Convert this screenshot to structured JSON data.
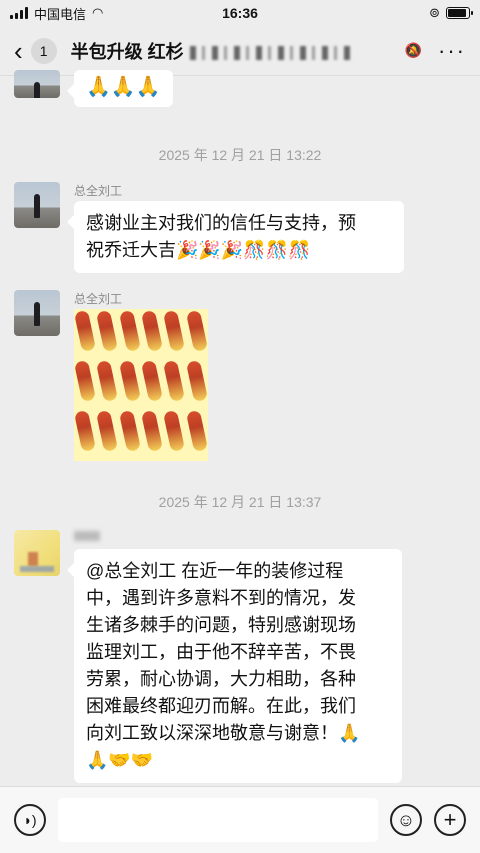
{
  "status_bar": {
    "carrier": "中国电信",
    "time": "16:36"
  },
  "header": {
    "back_count": "1",
    "title": "半包升级 红杉"
  },
  "messages": {
    "m1": {
      "content": "🙏🙏🙏"
    },
    "ts1": "2025 年 12 月 21 日 13:22",
    "m2": {
      "sender": "总全刘工",
      "text_line1": "感谢业主对我们的信任与支持，预",
      "text_line2": "祝乔迁大吉🎉🎉🎉🎊🎊🎊"
    },
    "m3": {
      "sender": "总全刘工"
    },
    "ts2": "2025 年 12 月 21 日 13:37",
    "m4": {
      "lines": [
        "@总全刘工 在近一年的装修过程",
        "中，遇到许多意料不到的情况，发",
        "生诸多棘手的问题，特别感谢现场",
        "监理刘工，由于他不辞辛苦，不畏",
        "劳累，耐心协调，大力相助，各种",
        "困难最终都迎刃而解。在此，我们",
        "向刘工致以深深地敬意与谢意！🙏",
        "🙏🤝🤝"
      ]
    }
  }
}
